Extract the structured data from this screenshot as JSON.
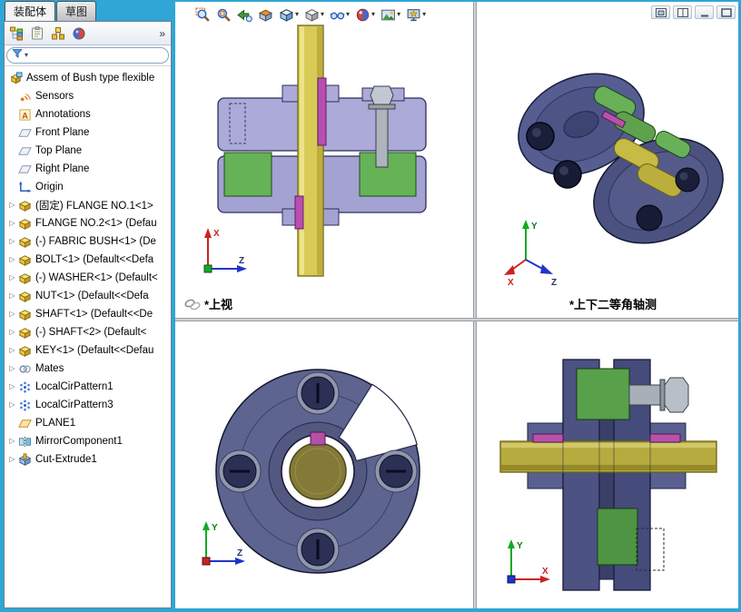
{
  "command_tabs": [
    {
      "label": "装配体",
      "active": true
    },
    {
      "label": "草图",
      "active": false
    }
  ],
  "panel_toolbar": {
    "icons": [
      "featuremanager-tree",
      "propertymanager",
      "configurationmanager",
      "displaymanager"
    ],
    "overflow": "»"
  },
  "feature_tree": {
    "root": {
      "label": "Assem of Bush type flexible",
      "icon": "assembly"
    },
    "items": [
      {
        "label": "Sensors",
        "icon": "sensors",
        "arrow": false
      },
      {
        "label": "Annotations",
        "icon": "annotations",
        "arrow": false
      },
      {
        "label": "Front Plane",
        "icon": "plane",
        "arrow": false
      },
      {
        "label": "Top Plane",
        "icon": "plane",
        "arrow": false
      },
      {
        "label": "Right Plane",
        "icon": "plane",
        "arrow": false
      },
      {
        "label": "Origin",
        "icon": "origin",
        "arrow": false
      },
      {
        "label": "(固定) FLANGE NO.1<1>",
        "icon": "part",
        "arrow": true
      },
      {
        "label": "FLANGE NO.2<1> (Defau",
        "icon": "part",
        "arrow": true
      },
      {
        "label": "(-) FABRIC BUSH<1> (De",
        "icon": "part",
        "arrow": true
      },
      {
        "label": "BOLT<1> (Default<<Defa",
        "icon": "part",
        "arrow": true
      },
      {
        "label": "(-) WASHER<1> (Default<",
        "icon": "part",
        "arrow": true
      },
      {
        "label": "NUT<1> (Default<<Defa",
        "icon": "part",
        "arrow": true
      },
      {
        "label": "SHAFT<1> (Default<<De",
        "icon": "part",
        "arrow": true
      },
      {
        "label": "(-) SHAFT<2> (Default<",
        "icon": "part",
        "arrow": true
      },
      {
        "label": "KEY<1> (Default<<Defau",
        "icon": "part",
        "arrow": true
      },
      {
        "label": "Mates",
        "icon": "mates",
        "arrow": true
      },
      {
        "label": "LocalCirPattern1",
        "icon": "pattern",
        "arrow": true
      },
      {
        "label": "LocalCirPattern3",
        "icon": "pattern",
        "arrow": true
      },
      {
        "label": "PLANE1",
        "icon": "refplane",
        "arrow": false
      },
      {
        "label": "MirrorComponent1",
        "icon": "mirror",
        "arrow": true
      },
      {
        "label": "Cut-Extrude1",
        "icon": "cut",
        "arrow": true
      }
    ]
  },
  "heads_up_toolbar": [
    {
      "icon": "zoom-fit",
      "caret": false
    },
    {
      "icon": "zoom-area",
      "caret": false
    },
    {
      "icon": "previous-view",
      "caret": false
    },
    {
      "icon": "section-view",
      "caret": false
    },
    {
      "icon": "view-orientation",
      "caret": true
    },
    {
      "icon": "display-style",
      "caret": true
    },
    {
      "icon": "hide-show-items",
      "caret": true
    },
    {
      "icon": "edit-appearance",
      "caret": true
    },
    {
      "icon": "apply-scene",
      "caret": true
    },
    {
      "icon": "view-settings",
      "caret": true
    }
  ],
  "window_controls": [
    {
      "icon": "restore-pane"
    },
    {
      "icon": "split-pane"
    },
    {
      "icon": "minimize-window"
    },
    {
      "icon": "maximize-window"
    }
  ],
  "viewport": {
    "views": [
      {
        "name": "top-view",
        "label": "*上视"
      },
      {
        "name": "dimetric-view",
        "label": "*上下二等角轴测"
      },
      {
        "name": "front-view",
        "label": ""
      },
      {
        "name": "side-view",
        "label": ""
      }
    ],
    "triad_labels": {
      "x": "X",
      "y": "Y",
      "z": "Z"
    }
  },
  "colors": {
    "frame": "#2fa6d6",
    "flange_lavender": "#abaad8",
    "flange_navy": "#4c5282",
    "bush_green": "#66b257",
    "shaft_yellow": "#d8cb55",
    "shaft_olive": "#837a38",
    "key_magenta": "#b553a8",
    "bolt_gray": "#aeb4bd"
  }
}
